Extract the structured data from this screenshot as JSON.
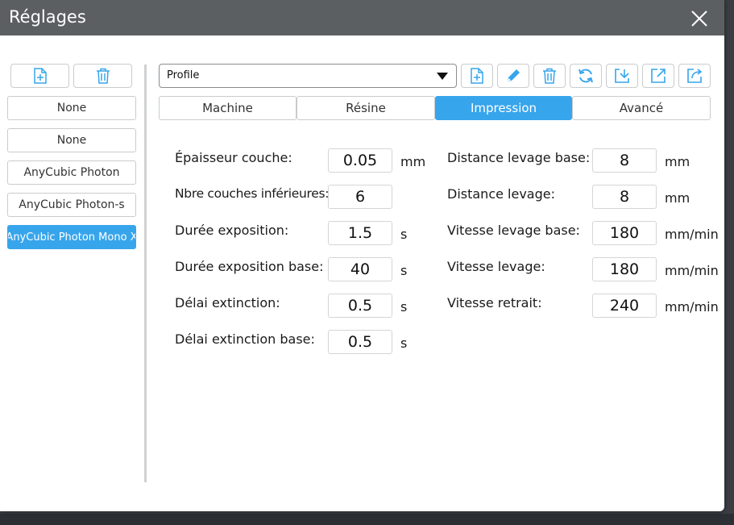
{
  "window": {
    "title": "Réglages"
  },
  "sidebar": {
    "items": [
      {
        "label": "None"
      },
      {
        "label": "None"
      },
      {
        "label": "AnyCubic Photon"
      },
      {
        "label": "AnyCubic Photon-s"
      },
      {
        "label": "AnyCubic Photon Mono X",
        "selected": true
      }
    ]
  },
  "profile": {
    "selected": "Profile"
  },
  "tabs": [
    {
      "label": "Machine"
    },
    {
      "label": "Résine"
    },
    {
      "label": "Impression",
      "active": true
    },
    {
      "label": "Avancé"
    }
  ],
  "settings": {
    "left": [
      {
        "label": "Épaisseur couche:",
        "value": "0.05",
        "unit": "mm"
      },
      {
        "label": "Nbre couches inférieures:",
        "value": "6",
        "unit": ""
      },
      {
        "label": "Durée exposition:",
        "value": "1.5",
        "unit": "s"
      },
      {
        "label": "Durée exposition base:",
        "value": "40",
        "unit": "s"
      },
      {
        "label": "Délai extinction:",
        "value": "0.5",
        "unit": "s"
      },
      {
        "label": "Délai extinction base:",
        "value": "0.5",
        "unit": "s"
      }
    ],
    "right": [
      {
        "label": "Distance levage base:",
        "value": "8",
        "unit": "mm"
      },
      {
        "label": "Distance levage:",
        "value": "8",
        "unit": "mm"
      },
      {
        "label": "Vitesse levage base:",
        "value": "180",
        "unit": "mm/min"
      },
      {
        "label": "Vitesse levage:",
        "value": "180",
        "unit": "mm/min"
      },
      {
        "label": "Vitesse retrait:",
        "value": "240",
        "unit": "mm/min"
      }
    ]
  },
  "colors": {
    "accent": "#37a5ec",
    "titlebar": "#5c5f62",
    "icon": "#37a5ec"
  }
}
